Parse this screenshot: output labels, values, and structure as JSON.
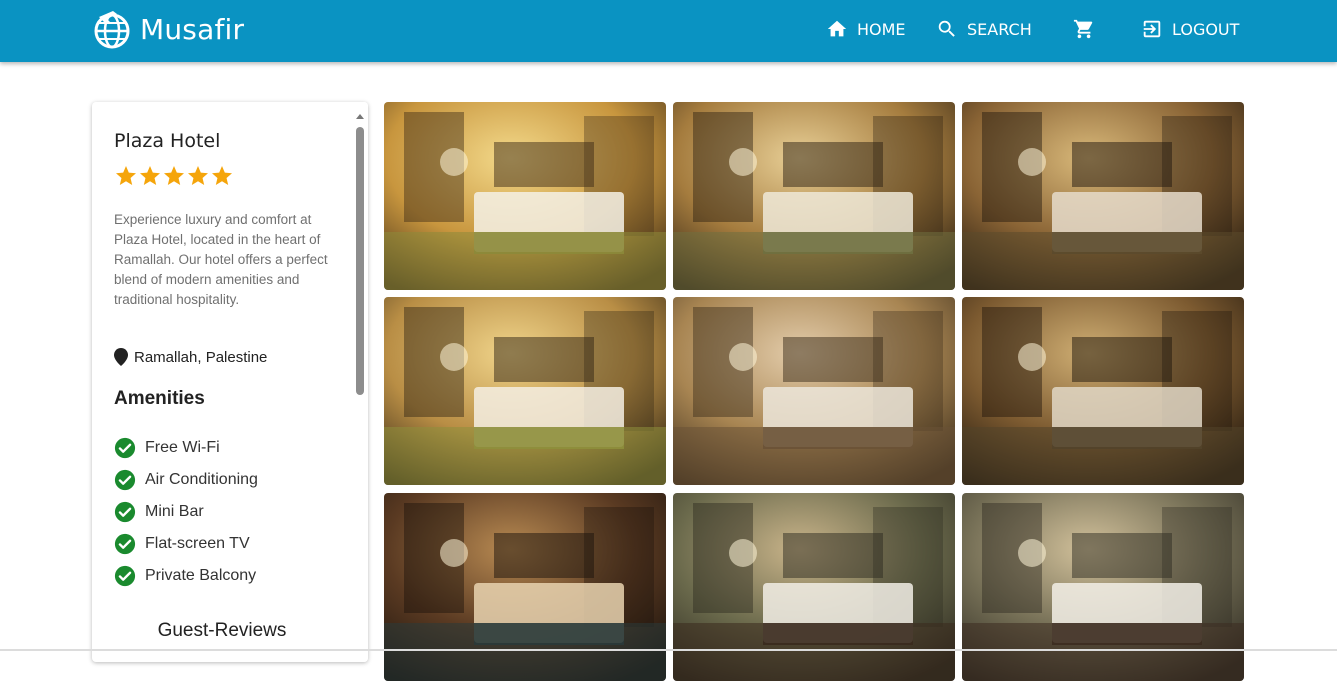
{
  "app": {
    "name": "Musafir"
  },
  "nav": {
    "home": "HOME",
    "search": "SEARCH",
    "logout": "LOGOUT"
  },
  "hotel": {
    "name": "Plaza Hotel",
    "rating": 5,
    "description": "Experience luxury and comfort at Plaza Hotel, located in the heart of Ramallah. Our hotel offers a perfect blend of modern amenities and traditional hospitality.",
    "location": "Ramallah, Palestine"
  },
  "amenities": {
    "title": "Amenities",
    "items": [
      "Free Wi-Fi",
      "Air Conditioning",
      "Mini Bar",
      "Flat-screen TV",
      "Private Balcony"
    ]
  },
  "reviews": {
    "title": "Guest-Reviews"
  },
  "gallery": {
    "photos": [
      {
        "name": "bedroom-twin-beds-photo"
      },
      {
        "name": "bedroom-fisheye-photo"
      },
      {
        "name": "suite-lounge-photo"
      },
      {
        "name": "bedroom-headboards-photo"
      },
      {
        "name": "suite-sofa-photo"
      },
      {
        "name": "suite-lounge-dark-photo"
      },
      {
        "name": "spa-pool-photo"
      },
      {
        "name": "spa-treatment-room-photo"
      },
      {
        "name": "spa-massage-room-photo"
      }
    ]
  },
  "colors": {
    "appbar": "#0a93c2",
    "star": "#f5a50b",
    "check": "#1a8a2e"
  }
}
